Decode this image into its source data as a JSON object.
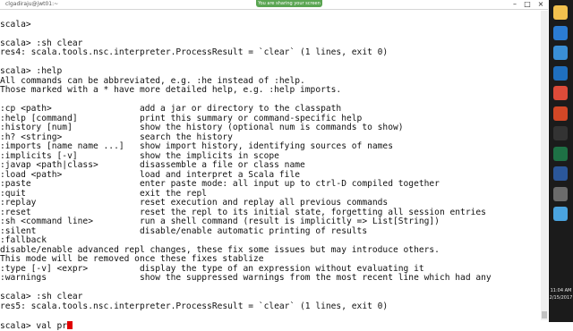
{
  "window": {
    "title": "clgadiraju@jwt01:~"
  },
  "banner": {
    "text": "You are sharing your screen"
  },
  "terminal": {
    "lines": [
      "",
      "scala> ",
      "",
      "scala> :sh clear",
      "res4: scala.tools.nsc.interpreter.ProcessResult = `clear` (1 lines, exit 0)",
      "",
      "scala> :help",
      "All commands can be abbreviated, e.g. :he instead of :help.",
      "Those marked with a * have more detailed help, e.g. :help imports.",
      "",
      ":cp <path>                 add a jar or directory to the classpath",
      ":help [command]            print this summary or command-specific help",
      ":history [num]             show the history (optional num is commands to show)",
      ":h? <string>               search the history",
      ":imports [name name ...]   show import history, identifying sources of names",
      ":implicits [-v]            show the implicits in scope",
      ":javap <path|class>        disassemble a file or class name",
      ":load <path>               load and interpret a Scala file",
      ":paste                     enter paste mode: all input up to ctrl-D compiled together",
      ":quit                      exit the repl",
      ":replay                    reset execution and replay all previous commands",
      ":reset                     reset the repl to its initial state, forgetting all session entries",
      ":sh <command line>         run a shell command (result is implicitly => List[String])",
      ":silent                    disable/enable automatic printing of results",
      ":fallback",
      "disable/enable advanced repl changes, these fix some issues but may introduce others.",
      "This mode will be removed once these fixes stablize",
      ":type [-v] <expr>          display the type of an expression without evaluating it",
      ":warnings                  show the suppressed warnings from the most recent line which had any",
      "",
      "scala> :sh clear",
      "res5: scala.tools.nsc.interpreter.ProcessResult = `clear` (1 lines, exit 0)",
      ""
    ],
    "prompt_line": "scala> val pr"
  },
  "taskbar": {
    "time": "11:04 AM",
    "date": "2/15/2017",
    "icons": [
      {
        "name": "file-explorer-icon",
        "color": "#f2c14e"
      },
      {
        "name": "edge-icon",
        "color": "#2b7cd3"
      },
      {
        "name": "windows-store-icon",
        "color": "#3a8fd6"
      },
      {
        "name": "mail-icon",
        "color": "#1f6fbf"
      },
      {
        "name": "chrome-icon",
        "color": "#dd4b39"
      },
      {
        "name": "powerpoint-icon",
        "color": "#d24726"
      },
      {
        "name": "terminal-icon",
        "color": "#333333"
      },
      {
        "name": "excel-icon",
        "color": "#1e7145"
      },
      {
        "name": "word-icon",
        "color": "#2b579a"
      },
      {
        "name": "settings-icon",
        "color": "#6b6b6b"
      },
      {
        "name": "app-icon",
        "color": "#4aa3df"
      }
    ]
  }
}
